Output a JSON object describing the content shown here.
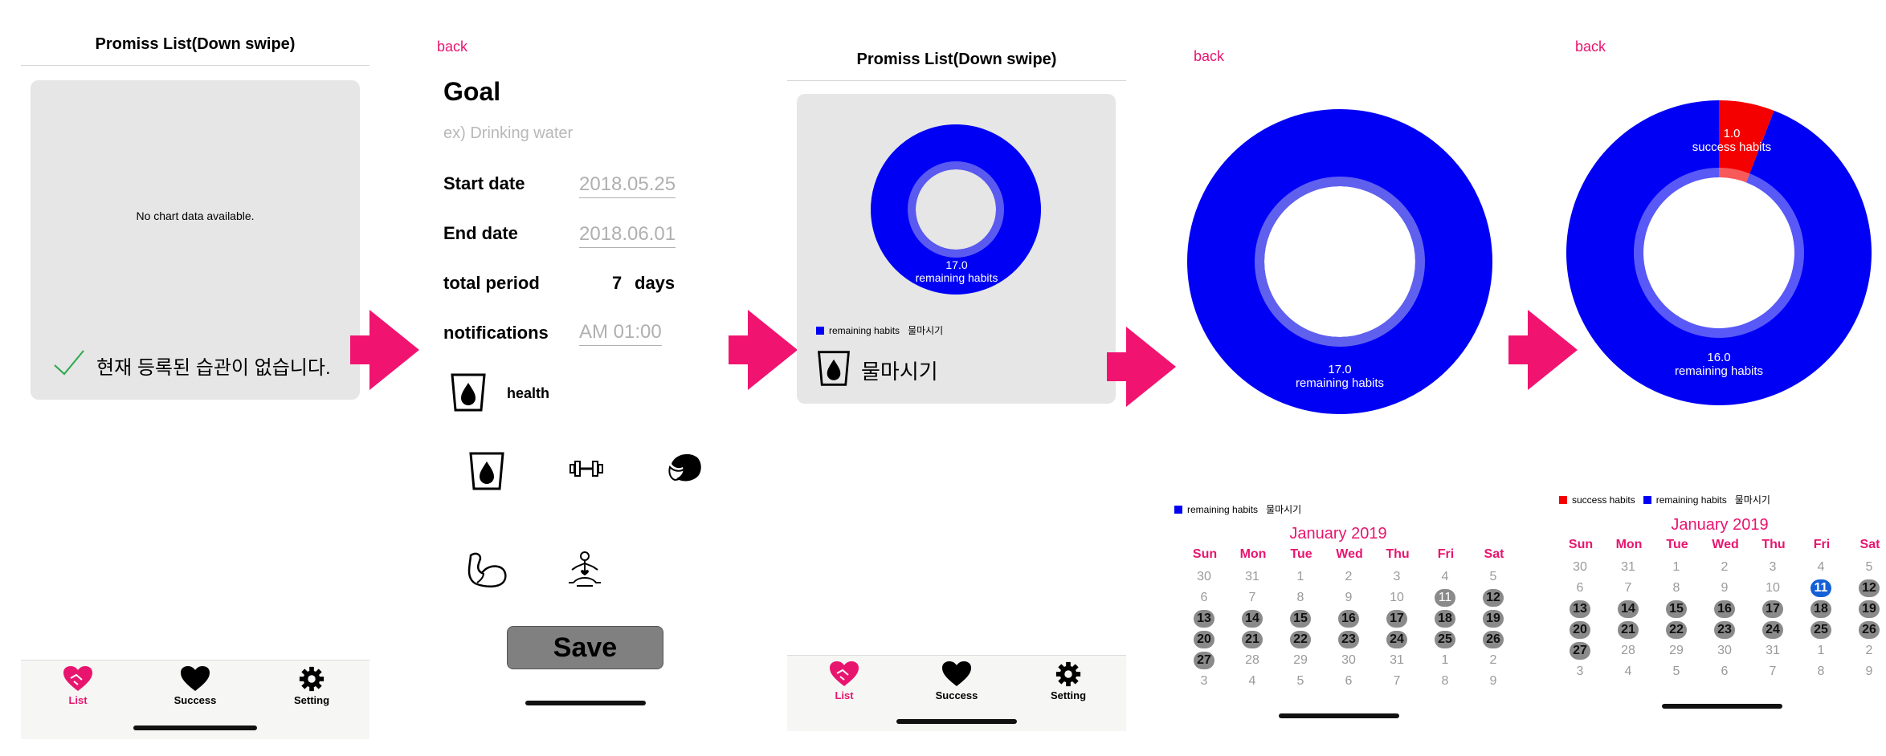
{
  "screen1": {
    "title": "Promiss List(Down swipe)",
    "no_data": "No chart data available.",
    "empty_message": "현재 등록된 습관이 없습니다.",
    "tabs": [
      "List",
      "Success",
      "Setting"
    ]
  },
  "screen2": {
    "back": "back",
    "goal_label": "Goal",
    "goal_placeholder": "ex) Drinking water",
    "start_label": "Start date",
    "start_value": "2018.05.25",
    "end_label": "End date",
    "end_value": "2018.06.01",
    "period_label": "total period",
    "period_value": "7",
    "period_unit": "days",
    "notif_label": "notifications",
    "notif_value": "AM 01:00",
    "category": "health",
    "save": "Save"
  },
  "screen3": {
    "title": "Promiss List(Down swipe)",
    "donut_value": "17.0",
    "donut_label": "remaining habits",
    "legend_label": "remaining habits",
    "legend_habit": "물마시기",
    "habit_name": "물마시기",
    "tabs": [
      "List",
      "Success",
      "Setting"
    ]
  },
  "screen4": {
    "back": "back",
    "donut_value": "17.0",
    "donut_label": "remaining habits",
    "legend_label": "remaining habits",
    "legend_habit": "물마시기",
    "month": "January 2019"
  },
  "screen5": {
    "back": "back",
    "success_value": "1.0",
    "success_label": "success habits",
    "remaining_value": "16.0",
    "remaining_label": "remaining habits",
    "legend_success": "success habits",
    "legend_remaining": "remaining habits",
    "legend_habit": "물마시기",
    "month": "January 2019"
  },
  "calendar": {
    "weekdays": [
      "Sun",
      "Mon",
      "Tue",
      "Wed",
      "Thu",
      "Fri",
      "Sat"
    ],
    "weeks": [
      [
        "30",
        "31",
        "1",
        "2",
        "3",
        "4",
        "5"
      ],
      [
        "6",
        "7",
        "8",
        "9",
        "10",
        "11",
        "12"
      ],
      [
        "13",
        "14",
        "15",
        "16",
        "17",
        "18",
        "19"
      ],
      [
        "20",
        "21",
        "22",
        "23",
        "24",
        "25",
        "26"
      ],
      [
        "27",
        "28",
        "29",
        "30",
        "31",
        "1",
        "2"
      ],
      [
        "3",
        "4",
        "5",
        "6",
        "7",
        "8",
        "9"
      ]
    ]
  },
  "colors": {
    "accent": "#e8156f",
    "remaining": "#0000f5",
    "success": "#f50000",
    "today": "#1560d6"
  }
}
